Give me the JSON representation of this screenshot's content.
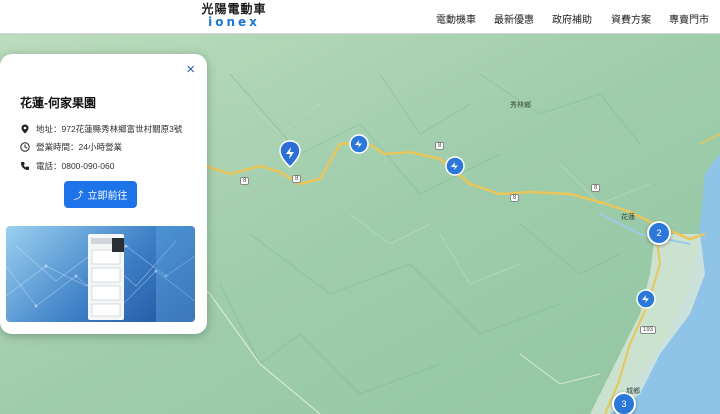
{
  "header": {
    "logo_cn": "光陽電動車",
    "logo_en": "ionex",
    "nav": [
      "電動機車",
      "最新優惠",
      "政府補助",
      "資費方案",
      "專賣門市"
    ]
  },
  "card": {
    "close": "×",
    "title": "花蓮-何家果園",
    "address": "地址：972花蓮縣秀林鄉富世村關原3號",
    "hours": "營業時間：24小時營業",
    "phone": "電話：0800-090-060",
    "go_button": "立即前往"
  },
  "map": {
    "labels": [
      "秀林鄉",
      "花蓮",
      "城鄉"
    ],
    "clusters": [
      "2",
      "3"
    ],
    "road_numbers": [
      "8",
      "8",
      "8",
      "8",
      "8",
      "193"
    ]
  },
  "colors": {
    "accent": "#1e73e8",
    "road": "#e8c65a",
    "sea": "#8fc4e8",
    "land": "#a9d3b4"
  }
}
